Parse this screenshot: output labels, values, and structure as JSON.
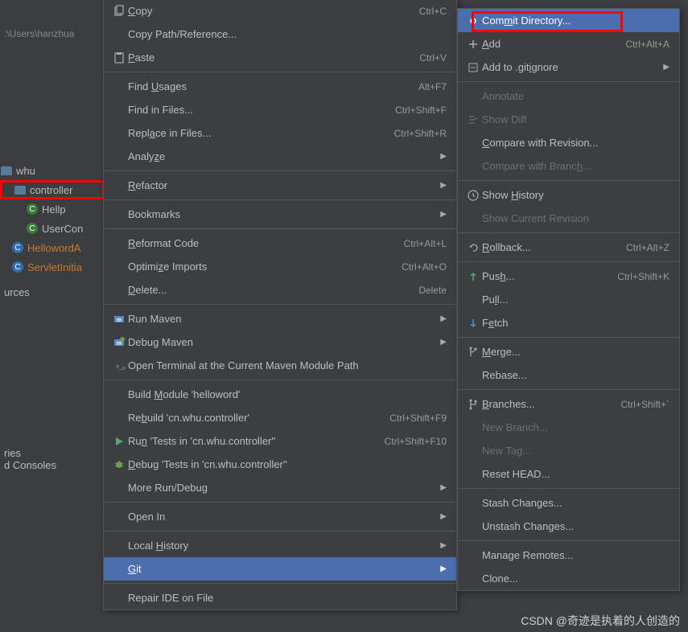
{
  "bg": {
    "path": ":\\Users\\hanzhua"
  },
  "tree": {
    "items": [
      {
        "name": "whu-item",
        "icon": "folder",
        "label": "whu",
        "indent": 0,
        "cls": ""
      },
      {
        "name": "controller-item",
        "icon": "folder",
        "label": "controller",
        "indent": 14,
        "cls": "highlight-red"
      },
      {
        "name": "hellp-item",
        "icon": "class",
        "label": "Hellp",
        "indent": 32,
        "cls": ""
      },
      {
        "name": "usercon-item",
        "icon": "class",
        "label": "UserCon",
        "indent": 32,
        "cls": ""
      },
      {
        "name": "helloworda-item",
        "icon": "blue",
        "label": "HellowordA",
        "indent": 14,
        "cls": "",
        "color": "orange"
      },
      {
        "name": "servletinitia-item",
        "icon": "blue",
        "label": "ServletInitia",
        "indent": 14,
        "cls": "",
        "color": "orange"
      }
    ],
    "extra1": "urces",
    "extra2_line1": "ries",
    "extra2_line2": "d Consoles"
  },
  "menu1": [
    {
      "type": "row",
      "name": "copy",
      "icon": "copy",
      "label": "<u>C</u>opy",
      "shortcut": "Ctrl+C"
    },
    {
      "type": "row",
      "name": "copy-path",
      "label": "Copy Path/Reference..."
    },
    {
      "type": "row",
      "name": "paste",
      "icon": "paste",
      "label": "<u>P</u>aste",
      "shortcut": "Ctrl+V"
    },
    {
      "type": "sep"
    },
    {
      "type": "row",
      "name": "find-usages",
      "label": "Find <u>U</u>sages",
      "shortcut": "Alt+F7"
    },
    {
      "type": "row",
      "name": "find-in-files",
      "label": "Find in Files...",
      "shortcut": "Ctrl+Shift+F"
    },
    {
      "type": "row",
      "name": "replace-in-files",
      "label": "Repl<u>a</u>ce in Files...",
      "shortcut": "Ctrl+Shift+R"
    },
    {
      "type": "row",
      "name": "analyze",
      "label": "Analy<u>z</u>e",
      "submenu": true
    },
    {
      "type": "sep"
    },
    {
      "type": "row",
      "name": "refactor",
      "label": "<u>R</u>efactor",
      "submenu": true
    },
    {
      "type": "sep"
    },
    {
      "type": "row",
      "name": "bookmarks",
      "label": "Bookmarks",
      "submenu": true
    },
    {
      "type": "sep"
    },
    {
      "type": "row",
      "name": "reformat",
      "label": "<u>R</u>eformat Code",
      "shortcut": "Ctrl+Alt+L"
    },
    {
      "type": "row",
      "name": "optimize-imports",
      "label": "Optimi<u>z</u>e Imports",
      "shortcut": "Ctrl+Alt+O"
    },
    {
      "type": "row",
      "name": "delete",
      "label": "<u>D</u>elete...",
      "shortcut": "Delete"
    },
    {
      "type": "sep"
    },
    {
      "type": "row",
      "name": "run-maven",
      "icon": "maven",
      "label": "Run Maven",
      "submenu": true
    },
    {
      "type": "row",
      "name": "debug-maven",
      "icon": "maven-d",
      "label": "Debug Maven",
      "submenu": true
    },
    {
      "type": "row",
      "name": "open-terminal",
      "icon": "maven-t",
      "label": "Open Terminal at the Current Maven Module Path"
    },
    {
      "type": "sep"
    },
    {
      "type": "row",
      "name": "build-module",
      "label": "Build <u>M</u>odule 'helloword'"
    },
    {
      "type": "row",
      "name": "rebuild",
      "label": "Re<u>b</u>uild 'cn.whu.controller'",
      "shortcut": "Ctrl+Shift+F9"
    },
    {
      "type": "row",
      "name": "run-tests",
      "icon": "run",
      "label": "Ru<u>n</u> 'Tests in 'cn.whu.controller''",
      "shortcut": "Ctrl+Shift+F10"
    },
    {
      "type": "row",
      "name": "debug-tests",
      "icon": "bug",
      "label": "<u>D</u>ebug 'Tests in 'cn.whu.controller''"
    },
    {
      "type": "row",
      "name": "more-run",
      "label": "More Run/Debug",
      "submenu": true
    },
    {
      "type": "sep"
    },
    {
      "type": "row",
      "name": "open-in",
      "label": "Open In",
      "submenu": true
    },
    {
      "type": "sep"
    },
    {
      "type": "row",
      "name": "local-history",
      "label": "Local <u>H</u>istory",
      "submenu": true
    },
    {
      "type": "row",
      "name": "git",
      "label": "<u>G</u>it",
      "submenu": true,
      "selected": true
    },
    {
      "type": "sep"
    },
    {
      "type": "row",
      "name": "repair-ide",
      "label": "Repair IDE on File"
    }
  ],
  "menu2": [
    {
      "type": "row",
      "name": "commit-dir",
      "icon": "commit",
      "label": "Com<u>m</u>it Directory...",
      "selected": true,
      "highlight": true
    },
    {
      "type": "row",
      "name": "add",
      "icon": "plus",
      "label": "<u>A</u>dd",
      "shortcut": "Ctrl+Alt+A"
    },
    {
      "type": "row",
      "name": "add-gitignore",
      "icon": "gitignore",
      "label": "Add to .git<u>i</u>gnore",
      "submenu": true
    },
    {
      "type": "sep"
    },
    {
      "type": "row",
      "name": "annotate",
      "label": "Annotate",
      "disabled": true
    },
    {
      "type": "row",
      "name": "show-diff",
      "icon": "diff",
      "label": "Show Diff",
      "disabled": true
    },
    {
      "type": "row",
      "name": "compare-rev",
      "label": "<u>C</u>ompare with Revision..."
    },
    {
      "type": "row",
      "name": "compare-branch",
      "label": "Compare with Branc<u>h</u>...",
      "disabled": true
    },
    {
      "type": "sep"
    },
    {
      "type": "row",
      "name": "show-history",
      "icon": "clock",
      "label": "Show <u>H</u>istory"
    },
    {
      "type": "row",
      "name": "show-cur-rev",
      "label": "Show Current Revision",
      "disabled": true
    },
    {
      "type": "sep"
    },
    {
      "type": "row",
      "name": "rollback",
      "icon": "rollback",
      "label": "<u>R</u>ollback...",
      "shortcut": "Ctrl+Alt+Z"
    },
    {
      "type": "sep"
    },
    {
      "type": "row",
      "name": "push",
      "icon": "push",
      "label": "Pus<u>h</u>...",
      "shortcut": "Ctrl+Shift+K"
    },
    {
      "type": "row",
      "name": "pull",
      "label": "Pu<u>l</u>l..."
    },
    {
      "type": "row",
      "name": "fetch",
      "icon": "fetch",
      "label": "F<u>e</u>tch"
    },
    {
      "type": "sep"
    },
    {
      "type": "row",
      "name": "merge",
      "icon": "merge",
      "label": "<u>M</u>erge..."
    },
    {
      "type": "row",
      "name": "rebase",
      "label": "Rebase..."
    },
    {
      "type": "sep"
    },
    {
      "type": "row",
      "name": "branches",
      "icon": "branch",
      "label": "<u>B</u>ranches...",
      "shortcut": "Ctrl+Shift+`"
    },
    {
      "type": "row",
      "name": "new-branch",
      "label": "New Branch...",
      "disabled": true
    },
    {
      "type": "row",
      "name": "new-tag",
      "label": "New Tag...",
      "disabled": true
    },
    {
      "type": "row",
      "name": "reset-head",
      "label": "Reset HEAD..."
    },
    {
      "type": "sep"
    },
    {
      "type": "row",
      "name": "stash",
      "label": "Stash Changes..."
    },
    {
      "type": "row",
      "name": "unstash",
      "label": "Unstash Changes..."
    },
    {
      "type": "sep"
    },
    {
      "type": "row",
      "name": "manage-remotes",
      "label": "Manage Remotes..."
    },
    {
      "type": "row",
      "name": "clone",
      "label": "Clone..."
    }
  ],
  "watermark": "CSDN @奇迹是执着的人创造的"
}
